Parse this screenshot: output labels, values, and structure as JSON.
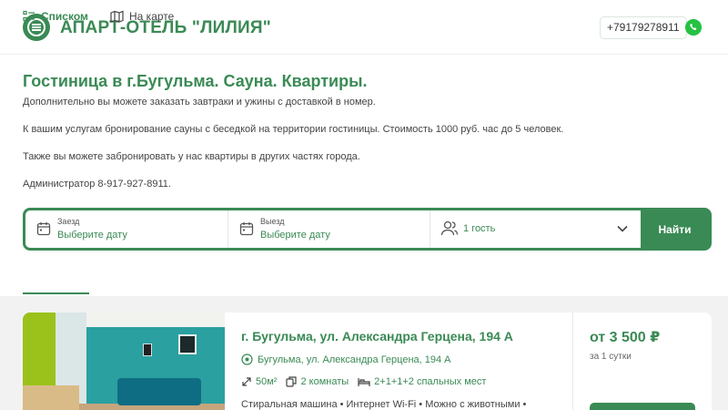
{
  "header": {
    "brand": "АПАРТ-ОТЕЛЬ \"ЛИЛИЯ\"",
    "phone": "+79179278911",
    "logo_icon": "hotel-logo-icon",
    "messenger_icon": "whatsapp-icon"
  },
  "intro": {
    "title": "Гостиница в г.Бугульма. Сауна. Квартиры.",
    "p1": "Дополнительно вы можете заказать завтраки и ужины с доставкой в номер.",
    "p2": "К вашим услугам бронирование сауны с беседкой на территории гостиницы. Стоимость 1000 руб. час до 5 человек.",
    "p3": "Также вы можете забронировать у нас квартиры в других частях города.",
    "p4": "Администратор 8-917-927-8911."
  },
  "search": {
    "checkin_label": "Заезд",
    "checkin_value": "Выберите дату",
    "checkout_label": "Выезд",
    "checkout_value": "Выберите дату",
    "guests_value": "1 гость",
    "submit_label": "Найти"
  },
  "tabs": {
    "list_label": "Списком",
    "map_label": "На карте"
  },
  "listing": {
    "title": "г. Бугульма, ул. Александра Герцена, 194 А",
    "address": "Бугульма, ул. Александра Герцена, 194 А",
    "area": "50м²",
    "rooms": "2 комнаты",
    "beds": "2+1+1+2 спальных мест",
    "amenities": "Стиральная машина • Интернет Wi-Fi • Можно с животными •",
    "price": "от 3 500 ₽",
    "per": "за 1 сутки"
  },
  "colors": {
    "brand_green": "#3a8a55",
    "whatsapp_green": "#25c243",
    "page_gray": "#f2f2f2"
  }
}
